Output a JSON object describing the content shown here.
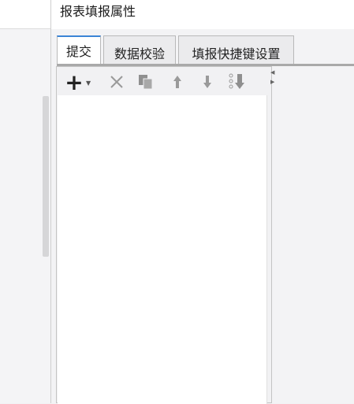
{
  "window": {
    "title": "报表填报属性"
  },
  "tabs": [
    {
      "label": "提交",
      "active": true
    },
    {
      "label": "数据校验",
      "active": false
    },
    {
      "label": "填报快捷键设置",
      "active": false
    }
  ],
  "toolbar": {
    "add_icon": "plus-icon",
    "delete_icon": "close-icon",
    "copy_icon": "copy-icon",
    "move_up_icon": "arrow-up-icon",
    "move_down_icon": "arrow-down-icon",
    "move_bottom_icon": "move-to-bottom-icon"
  },
  "colors": {
    "accent": "#3b84d6"
  }
}
